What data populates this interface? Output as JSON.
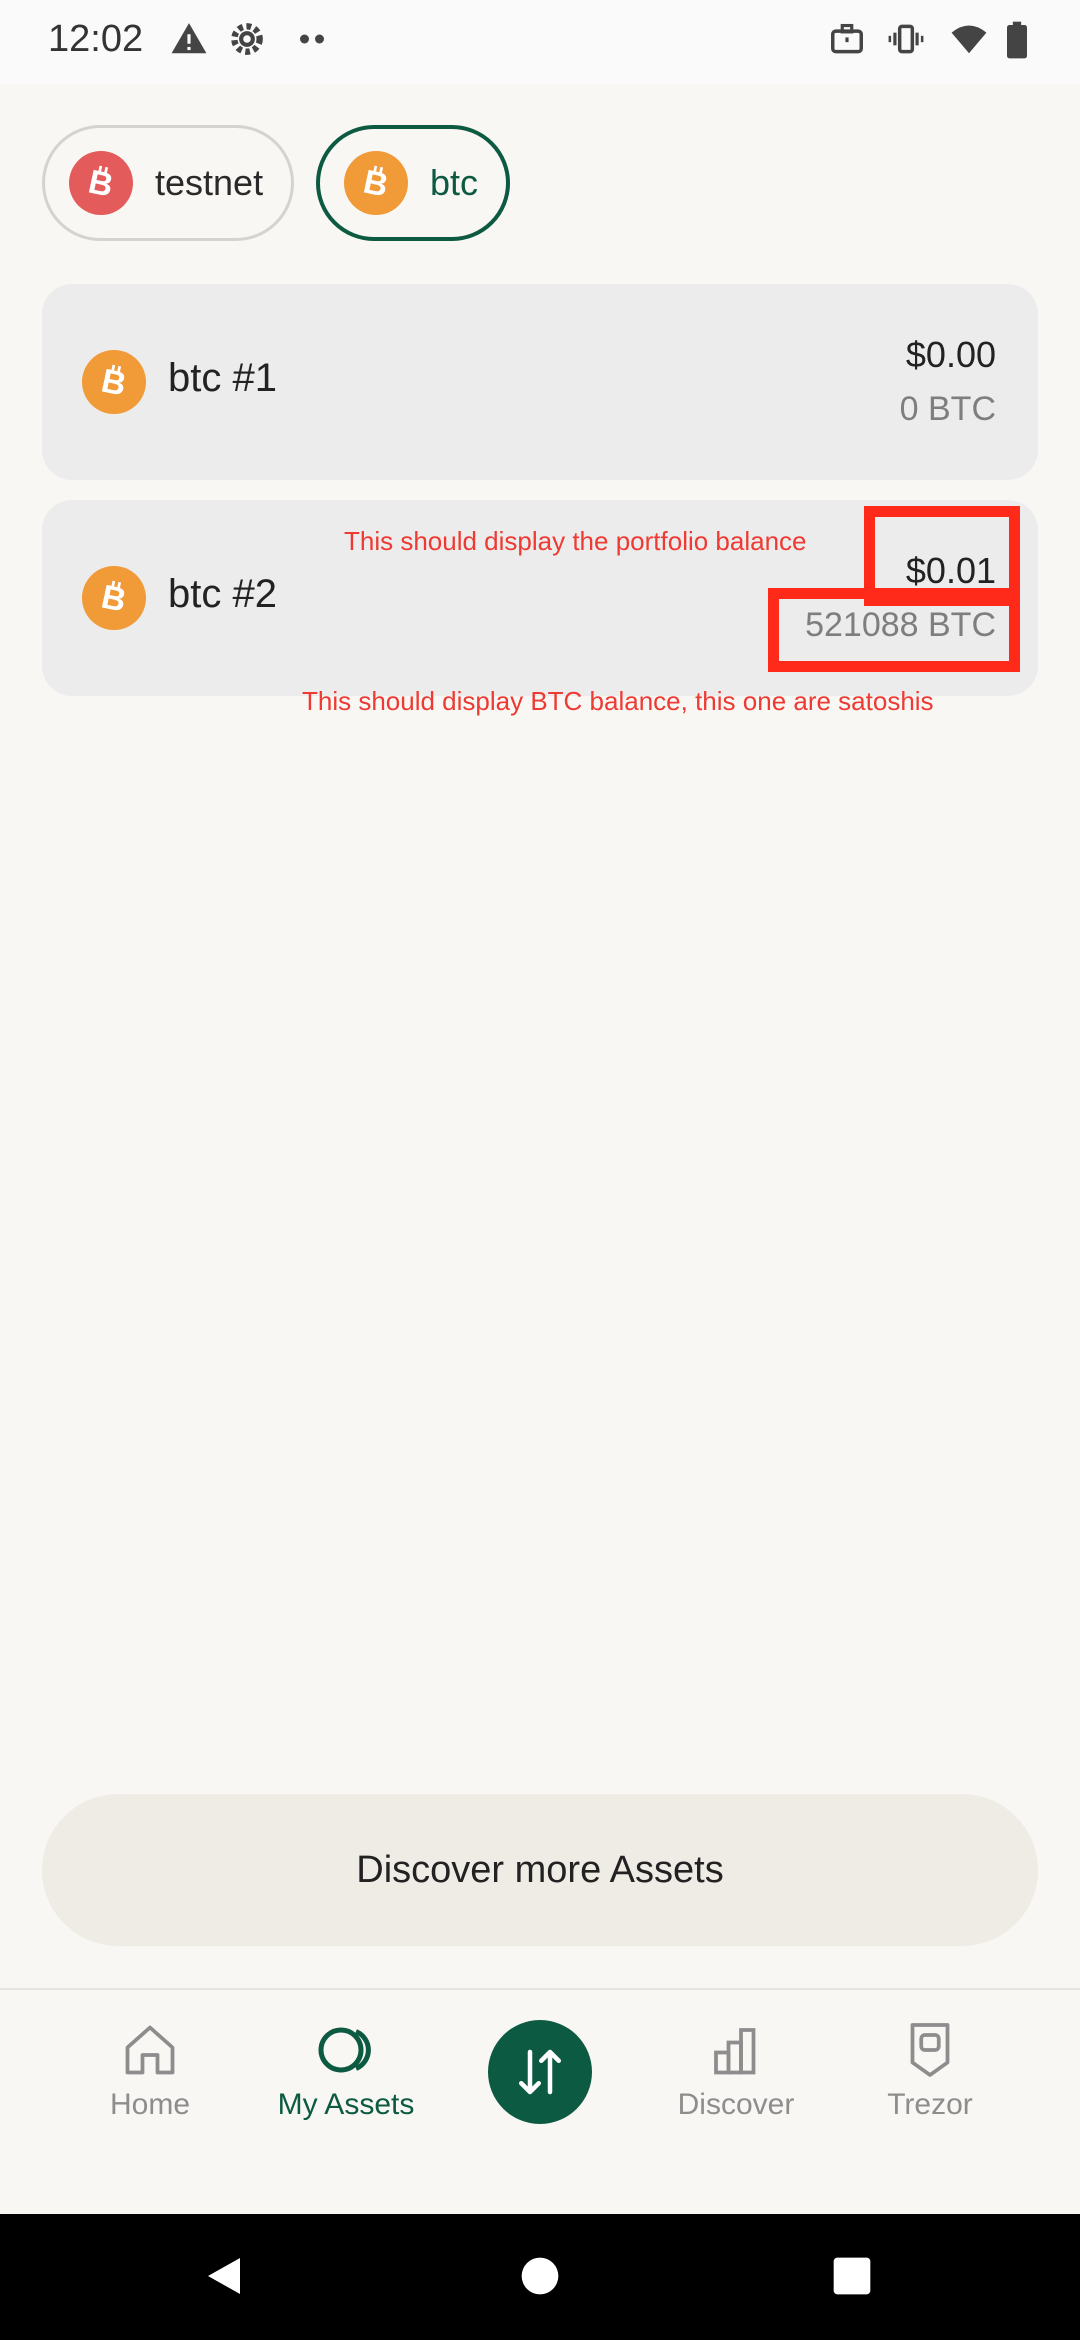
{
  "status_bar": {
    "time": "12:02",
    "left_icons": [
      "warning-icon",
      "gear-icon",
      "more-dots-icon"
    ],
    "right_icons": [
      "briefcase-icon",
      "vibrate-icon",
      "wifi-icon",
      "battery-icon"
    ]
  },
  "network_filters": [
    {
      "label": "testnet",
      "icon": "bitcoin-icon",
      "color": "#e35b5b",
      "selected": false
    },
    {
      "label": "btc",
      "icon": "bitcoin-icon",
      "color": "#f09a38",
      "selected": true
    }
  ],
  "accounts": [
    {
      "name": "btc #1",
      "fiat_balance": "$0.00",
      "crypto_balance": "0 BTC"
    },
    {
      "name": "btc #2",
      "fiat_balance": "$0.01",
      "crypto_balance": "521088 BTC"
    }
  ],
  "annotations": {
    "portfolio_note": "This should display the portfolio balance",
    "btc_note": "This should display BTC balance, this one are satoshis"
  },
  "discover_button": {
    "label": "Discover more Assets"
  },
  "bottom_nav": {
    "home": {
      "label": "Home",
      "icon": "home-icon"
    },
    "my_assets": {
      "label": "My Assets",
      "icon": "coins-icon",
      "active": true
    },
    "trade": {
      "icon": "swap-arrows-icon"
    },
    "discover": {
      "label": "Discover",
      "icon": "bar-chart-icon"
    },
    "trezor": {
      "label": "Trezor",
      "icon": "trezor-device-icon"
    }
  },
  "colors": {
    "brand_green": "#0d5a42",
    "bitcoin_orange": "#f09a38",
    "testnet_red": "#e35b5b",
    "annotation_red": "#ee3a33"
  }
}
